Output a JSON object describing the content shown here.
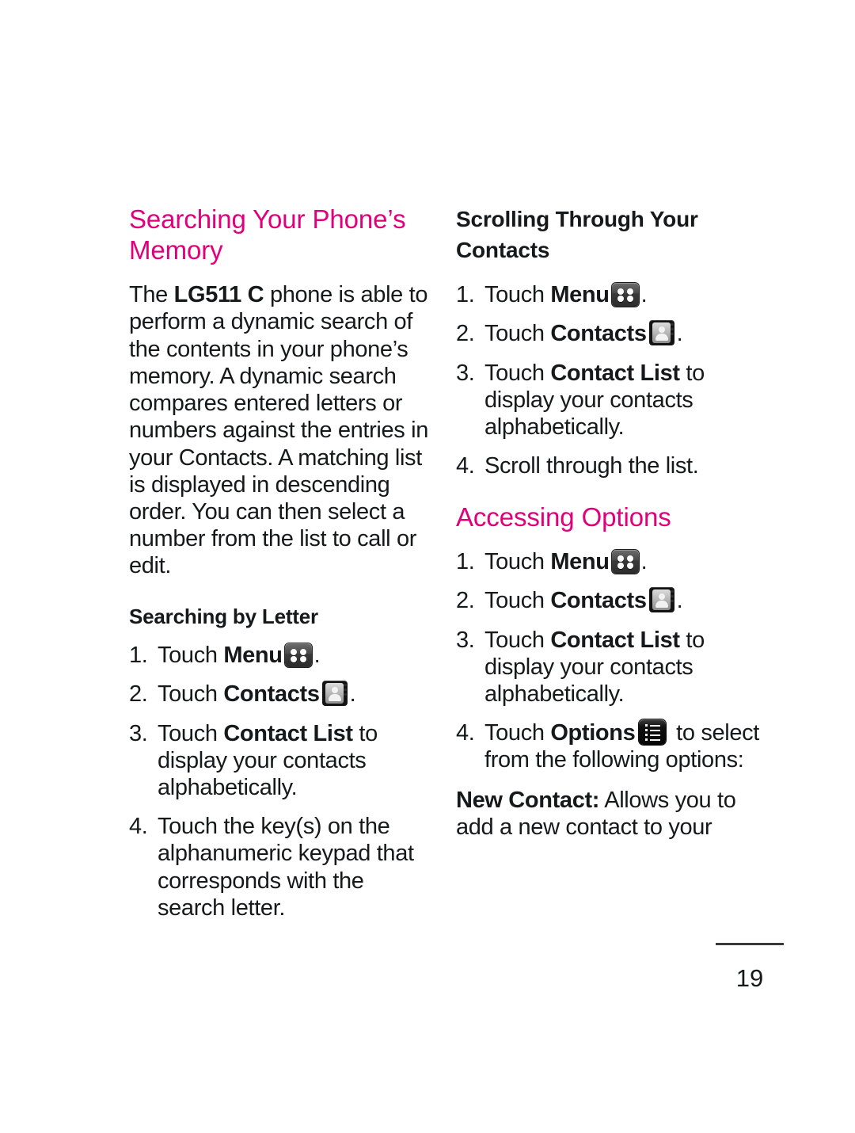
{
  "page": {
    "number": "19",
    "accent_color": "#E0007C",
    "text_color": "#16181a"
  },
  "icons": {
    "menu": "menu-grid-icon",
    "contacts": "contacts-book-icon",
    "options": "options-list-icon"
  },
  "left_column": {
    "heading": "Searching Your Phone’s Memory",
    "intro": {
      "lead": "The ",
      "bold": "LG511 C",
      "rest": " phone is able to perform a dynamic search of the contents in your phone’s memory. A dynamic search compares entered letters or numbers against the entries in your Contacts. A matching list is displayed in descending order. You can then select a number from the list to call or edit."
    },
    "subheading": "Searching by Letter",
    "steps": [
      {
        "num": "1.",
        "pre": "Touch ",
        "bold": "Menu",
        "post": ".",
        "icon": "menu"
      },
      {
        "num": "2.",
        "pre": "Touch ",
        "bold": "Contacts",
        "post": ".",
        "icon": "contacts"
      },
      {
        "num": "3.",
        "pre": "Touch ",
        "bold": "Contact List",
        "post": " to display your contacts alphabetically.",
        "icon": ""
      },
      {
        "num": "4.",
        "pre": "Touch the key(s) on the alphanumeric keypad that corresponds with the search letter.",
        "bold": "",
        "post": "",
        "icon": ""
      }
    ]
  },
  "right_column": {
    "section_one": {
      "heading": "Scrolling Through Your Contacts",
      "steps": [
        {
          "num": "1.",
          "pre": "Touch ",
          "bold": "Menu",
          "post": ".",
          "icon": "menu"
        },
        {
          "num": "2.",
          "pre": "Touch ",
          "bold": "Contacts",
          "post": ".",
          "icon": "contacts"
        },
        {
          "num": "3.",
          "pre": "Touch ",
          "bold": "Contact List",
          "post": " to display your contacts alphabetically.",
          "icon": ""
        },
        {
          "num": "4.",
          "pre": "Scroll through the list.",
          "bold": "",
          "post": "",
          "icon": ""
        }
      ]
    },
    "section_two": {
      "heading": "Accessing Options",
      "steps": [
        {
          "num": "1.",
          "pre": "Touch ",
          "bold": "Menu",
          "post": ".",
          "icon": "menu"
        },
        {
          "num": "2.",
          "pre": "Touch ",
          "bold": "Contacts",
          "post": ".",
          "icon": "contacts"
        },
        {
          "num": "3.",
          "pre": "Touch ",
          "bold": "Contact List",
          "post": " to display your contacts alphabetically.",
          "icon": ""
        },
        {
          "num": "4.",
          "pre": "Touch ",
          "bold": "Options",
          "post": " to select from the following options:",
          "icon": "options"
        }
      ],
      "option_item": {
        "bold": "New Contact:",
        "rest": " Allows you to add a new contact to your"
      }
    }
  }
}
